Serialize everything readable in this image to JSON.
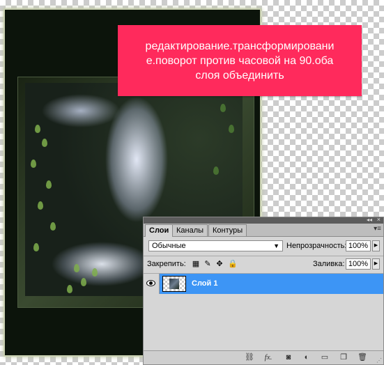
{
  "banner": {
    "line1": "редактирование.трансформировани",
    "line2": "е.поворот против часовой на 90.оба",
    "line3": "слоя объединить"
  },
  "layers_panel": {
    "tabs": [
      "Слои",
      "Каналы",
      "Контуры"
    ],
    "active_tab": "Слои",
    "blend_mode": "Обычные",
    "opacity_label": "Непрозрачность:",
    "opacity_value": "100%",
    "lock_label": "Закрепить:",
    "fill_label": "Заливка:",
    "fill_value": "100%",
    "layer": {
      "name": "Слой 1",
      "visible": true,
      "selected": true
    },
    "bottom_icons": [
      "link-icon",
      "fx-icon",
      "mask-icon",
      "adjustment-icon",
      "group-icon",
      "new-layer-icon",
      "trash-icon"
    ],
    "fx_glyph": "fx."
  },
  "colors": {
    "banner": "#ff2a5c",
    "selection": "#3d95f5",
    "panel": "#d6d6d6"
  }
}
